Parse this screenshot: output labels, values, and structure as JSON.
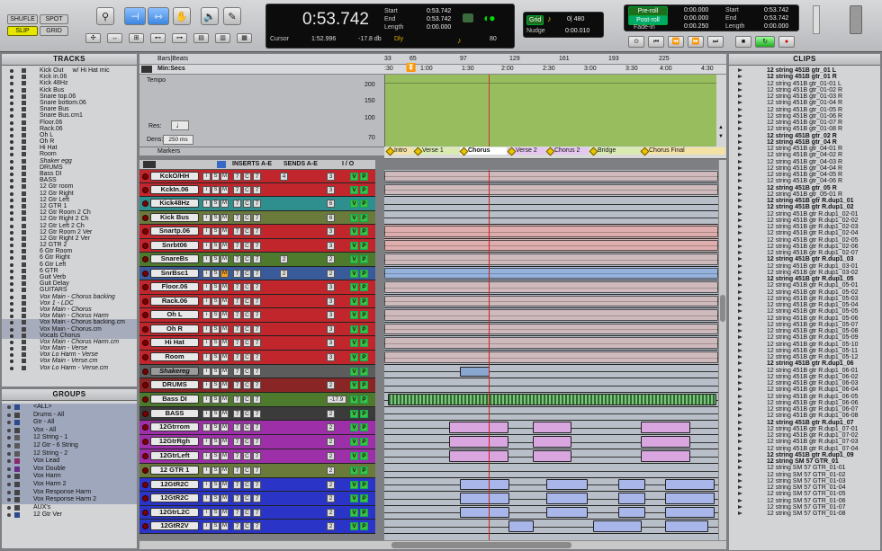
{
  "toolbar": {
    "modes": {
      "shuffle": "SHUFLE",
      "spot": "SPOT",
      "slip": "SLIP",
      "grid": "GRID"
    },
    "counter": {
      "main": "0:53.742",
      "cursor_label": "Cursor",
      "cursor_val": "1:52.996",
      "db_val": "-17.8 db",
      "dly": "Dly"
    },
    "selection": {
      "start_label": "Start",
      "end_label": "End",
      "length_label": "Length",
      "start": "0:53.742",
      "end": "0:53.742",
      "length": "0:00.000"
    },
    "tempo": "80",
    "grid": {
      "label": "Grid",
      "value": "0| 480",
      "nudge_label": "Nudge",
      "nudge_value": "0:00.010"
    },
    "transport": {
      "preroll_label": "Pre-roll",
      "postroll_label": "Post-roll",
      "fadein_label": "Fade-in",
      "preroll": "0:00.000",
      "postroll": "0:00.000",
      "fadein": "0:00.250",
      "start_label": "Start",
      "end_label": "End",
      "length_label": "Length",
      "start": "0:53.742",
      "end": "0:53.742",
      "length": "0:00.000"
    }
  },
  "panels": {
    "tracks": "TRACKS",
    "groups": "GROUPS",
    "clips": "CLIPS"
  },
  "tracks_list": [
    "Kick Out",
    "Kick in.06",
    "Kick 48Hz",
    "Kick Bus",
    "Snare top.06",
    "Snare bottom.06",
    "Snare Bus",
    "Snare Bus.cm1",
    "Floor.06",
    "Rack.06",
    "Oh L",
    "Oh R",
    "Hi Hat",
    "Room",
    "Shaker egg",
    "DRUMS",
    "Bass DI",
    "BASS",
    "12 Gtr room",
    "12 Gtr Right",
    "12 Gtr Left",
    "12 GTR 1",
    "12 Gtr Room 2 Ch",
    "12 Gtr Right 2 Ch",
    "12 Gtr Left 2 Ch",
    "12 Gtr Room 2 Ver",
    "12 Gtr Right 2 Ver",
    "12 GTR 2",
    "6 Gtr Room",
    "6 Gtr Right",
    "6 Gtr Left",
    "6 GTR",
    "Guit Verb",
    "Guit Delay",
    "GUITARS",
    "Vox Main - Chorus backing",
    "Vox 1 - LDC",
    "Vox Main - Chorus",
    "Vox Main - Chorus Harm",
    "Vox Main - Chorus backing.cm",
    "Vox Main - Chorus.cm",
    "Vocals Chorus",
    "Vox Main - Chorus Harm.cm",
    "Vox Main - Verse",
    "Vox Lo Harm - Verse",
    "Vox Main - Verse.cm",
    "Vox Lo Harm - Verse.cm"
  ],
  "tracks_list_extra": {
    "kick_out_suffix": "w/ Hi Hat mic"
  },
  "groups_list": [
    "<ALL>",
    "Drums - All",
    "Gtr - All",
    "Vox - All",
    "12 String - 1",
    "12 Gtr - 6 String",
    "12 String - 2",
    "Vox Lead",
    "Vox Double",
    "Vox Harm",
    "Vox Harm 2",
    "Vox Response Harm",
    "Vox Response Harm 2",
    "AUX's",
    "12 Gtr Ver"
  ],
  "clips_list": [
    "12 string 451B gtr_01 L",
    "12 string 451B gtr_01 R",
    "12 string 451B gtr_01-01 L",
    "12 string 451B gtr_01-02 R",
    "12 string 451B gtr_01-03 R",
    "12 string 451B gtr_01-04 R",
    "12 string 451B gtr_01-05 R",
    "12 string 451B gtr_01-06 R",
    "12 string 451B gtr_01-07 R",
    "12 string 451B gtr_01-08 R",
    "12 string 451B gtr_02 R",
    "12 string 451B gtr_04 R",
    "12 string 451B gtr_04-01 R",
    "12 string 451B gtr_04-02 R",
    "12 string 451B gtr_04-03 R",
    "12 string 451B gtr_04-04 R",
    "12 string 451B gtr_04-05 R",
    "12 string 451B gtr_04-06 R",
    "12 string 451B gtr_05 R",
    "12 string 451B gtr_05-01 R",
    "12 string 451B gtr R.dup1_01",
    "12 string 451B gtr R.dup1_02",
    "12 string 451B gtr R.dup1_02-01",
    "12 string 451B gtr R.dup1_02-02",
    "12 string 451B gtr R.dup1_02-03",
    "12 string 451B gtr R.dup1_02-04",
    "12 string 451B gtr R.dup1_02-05",
    "12 string 451B gtr R.dup1_02-06",
    "12 string 451B gtr R.dup1_02-07",
    "12 string 451B gtr R.dup1_03",
    "12 string 451B gtr R.dup1_03-01",
    "12 string 451B gtr R.dup1_03-02",
    "12 string 451B gtr R.dup1_05",
    "12 string 451B gtr R.dup1_05-01",
    "12 string 451B gtr R.dup1_05-02",
    "12 string 451B gtr R.dup1_05-03",
    "12 string 451B gtr R.dup1_05-04",
    "12 string 451B gtr R.dup1_05-05",
    "12 string 451B gtr R.dup1_05-06",
    "12 string 451B gtr R.dup1_05-07",
    "12 string 451B gtr R.dup1_05-08",
    "12 string 451B gtr R.dup1_05-09",
    "12 string 451B gtr R.dup1_05-10",
    "12 string 451B gtr R.dup1_05-11",
    "12 string 451B gtr R.dup1_05-12",
    "12 string 451B gtr R.dup1_06",
    "12 string 451B gtr R.dup1_06-01",
    "12 string 451B gtr R.dup1_06-02",
    "12 string 451B gtr R.dup1_06-03",
    "12 string 451B gtr R.dup1_06-04",
    "12 string 451B gtr R.dup1_06-05",
    "12 string 451B gtr R.dup1_06-06",
    "12 string 451B gtr R.dup1_06-07",
    "12 string 451B gtr R.dup1_06-08",
    "12 string 451B gtr R.dup1_07",
    "12 string 451B gtr R.dup1_07-01",
    "12 string 451B gtr R.dup1_07-02",
    "12 string 451B gtr R.dup1_07-03",
    "12 string 451B gtr R.dup1_07-04",
    "12 string 451B gtr R.dup1_09",
    "12 string SM 57 GTR_01",
    "12 string SM 57 GTR_01-01",
    "12 string SM 57 GTR_01-02",
    "12 string SM 57 GTR_01-03",
    "12 string SM 57 GTR_01-04",
    "12 string SM 57 GTR_01-05",
    "12 string SM 57 GTR_01-06",
    "12 string SM 57 GTR_01-07",
    "12 string SM 57 GTR_01-08"
  ],
  "rulers": {
    "bars_label": "Bars|Beats",
    "minsecs_label": "Min:Secs",
    "tempo_label": "Tempo",
    "markers_label": "Markers",
    "bars": [
      "33",
      "65",
      "97",
      "129",
      "161",
      "193",
      "225"
    ],
    "times": [
      ":30",
      "1:00",
      "1:30",
      "2:00",
      "2:30",
      "3:00",
      "3:30",
      "4:00",
      "4:30"
    ],
    "tempo_scale": [
      "200",
      "150",
      "100",
      "70"
    ],
    "res_label": "Res:",
    "dens_label": "Dens:",
    "dens_value": "250 ms"
  },
  "markers": [
    "Intro",
    "Verse 1",
    "Chorus",
    "Verse 2",
    "Chorus 2",
    "Bridge",
    "Chorus Final"
  ],
  "columns": {
    "inserts": "INSERTS A-E",
    "sends": "SENDS A-E",
    "io": "I / O"
  },
  "track_headers": [
    {
      "name": "KckO/HH",
      "color": "#c0262c",
      "send": "4",
      "io": "3"
    },
    {
      "name": "KckIn.06",
      "color": "#c0262c",
      "send": "",
      "io": "3"
    },
    {
      "name": "Kick48Hz",
      "color": "#2f8f8f",
      "send": "",
      "io": "6"
    },
    {
      "name": "Kick Bus",
      "color": "#6a7a3a",
      "send": "",
      "io": "6"
    },
    {
      "name": "Snartp.06",
      "color": "#c0262c",
      "send": "",
      "io": "3"
    },
    {
      "name": "Snrbt06",
      "color": "#c0262c",
      "send": "",
      "io": "3"
    },
    {
      "name": "SnareBs",
      "color": "#4e7a2e",
      "send": "2",
      "io": "2"
    },
    {
      "name": "SnrBsc1",
      "color": "#3a5b9a",
      "send": "2",
      "io": "2"
    },
    {
      "name": "Floor.06",
      "color": "#c0262c",
      "send": "",
      "io": "3"
    },
    {
      "name": "Rack.06",
      "color": "#c0262c",
      "send": "",
      "io": "3"
    },
    {
      "name": "Oh L",
      "color": "#c0262c",
      "send": "",
      "io": "3"
    },
    {
      "name": "Oh R",
      "color": "#c0262c",
      "send": "",
      "io": "3"
    },
    {
      "name": "Hi Hat",
      "color": "#c0262c",
      "send": "",
      "io": "3"
    },
    {
      "name": "Room",
      "color": "#c0262c",
      "send": "",
      "io": "3"
    },
    {
      "name": "Shakereg",
      "color": "#5c5c5c",
      "send": "",
      "io": ""
    },
    {
      "name": "DRUMS",
      "color": "#8a2525",
      "send": "",
      "io": "2"
    },
    {
      "name": "Bass DI",
      "color": "#4e7a2e",
      "send": "",
      "io": "-17.9"
    },
    {
      "name": "BASS",
      "color": "#3b3b3b",
      "send": "",
      "io": "2"
    },
    {
      "name": "12Gtrrom",
      "color": "#9d2fa8",
      "send": "",
      "io": "2"
    },
    {
      "name": "12GtrRgh",
      "color": "#9d2fa8",
      "send": "",
      "io": "2"
    },
    {
      "name": "12GtrLeft",
      "color": "#9d2fa8",
      "send": "",
      "io": "2"
    },
    {
      "name": "12 GTR 1",
      "color": "#6a7a3a",
      "send": "",
      "io": "2"
    },
    {
      "name": "12GtR2C",
      "color": "#2a35c8",
      "send": "",
      "io": "2"
    },
    {
      "name": "12GtR2C",
      "color": "#2a35c8",
      "send": "",
      "io": "2"
    },
    {
      "name": "12GtrL2C",
      "color": "#2a35c8",
      "send": "",
      "io": "2"
    },
    {
      "name": "12GtR2V",
      "color": "#2a35c8",
      "send": "",
      "io": "2"
    }
  ],
  "track_buttons": {
    "input": "i",
    "solo": "S",
    "mute": "M",
    "vol": "V",
    "pan": "P"
  }
}
